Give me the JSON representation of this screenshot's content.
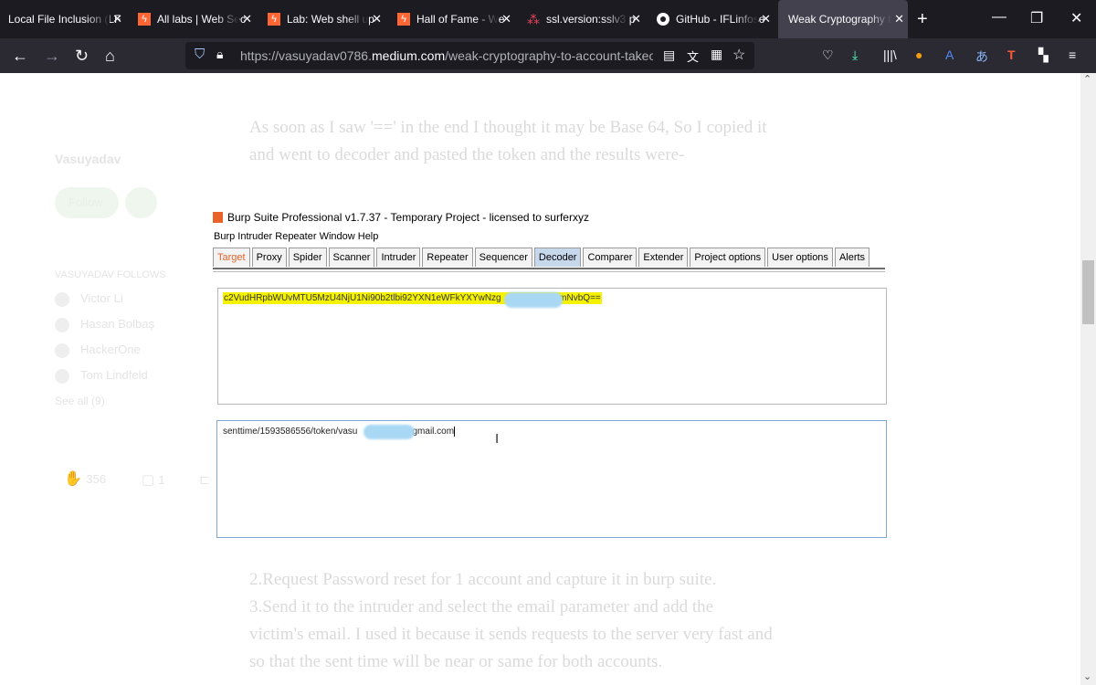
{
  "tabs": [
    {
      "title": "Local File Inclusion (LF",
      "icon": "none"
    },
    {
      "title": "All labs | Web Sec",
      "icon": "portswigger-icon"
    },
    {
      "title": "Lab: Web shell up",
      "icon": "portswigger-icon"
    },
    {
      "title": "Hall of Fame - We",
      "icon": "portswigger-icon"
    },
    {
      "title": "ssl.version:sslv3 p",
      "icon": "dots-icon"
    },
    {
      "title": "GitHub - IFLinfose",
      "icon": "github-icon"
    },
    {
      "title": "Weak Cryptography t",
      "icon": "none"
    }
  ],
  "address_bar": {
    "url_prefix": "https://vasuyadav0786.",
    "url_domain": "medium.com",
    "url_path": "/weak-cryptography-to-account-takeovers-"
  },
  "article": {
    "para1_line1": "As soon as I saw '==' in the end I thought it may be Base 64, So I copied it",
    "para1_line2": "and went to decoder and pasted the token and the results were-",
    "para2_line1": "2.Request Password reset for 1 account and capture it in burp suite.",
    "para2_line2": "3.Send it to the intruder and select the email parameter and add the",
    "para2_line3": "victim's email. I used it because it sends requests to the server very fast and",
    "para2_line4": "so that the sent time will be near or same for both accounts."
  },
  "sidebar": {
    "author": "Vasuyadav",
    "follow": "Follow",
    "follows_header": "VASUYADAV FOLLOWS",
    "follows": [
      "Victor Li",
      "Hasan Bolbaş",
      "HackerOne",
      "Tom Lindfeld"
    ],
    "see_all": "See all (9)",
    "claps": "356",
    "comments": "1"
  },
  "burp": {
    "title": "Burp Suite Professional v1.7.37 - Temporary Project - licensed to surferxyz",
    "menu": "Burp  Intruder  Repeater  Window  Help",
    "tabs": [
      "Target",
      "Proxy",
      "Spider",
      "Scanner",
      "Intruder",
      "Repeater",
      "Sequencer",
      "Decoder",
      "Comparer",
      "Extender",
      "Project options",
      "User options",
      "Alerts"
    ],
    "selected_tab": "Decoder",
    "encoded_start": "c2VudHRpbWUvMTU5MzU4NjU1Ni90b2tlbi92YXN1eWFkYXYwNzg",
    "encoded_end": "LmNvbQ==",
    "decoded_start": "senttime/1593586556/token/vasu",
    "decoded_end": "@gmail.com"
  }
}
